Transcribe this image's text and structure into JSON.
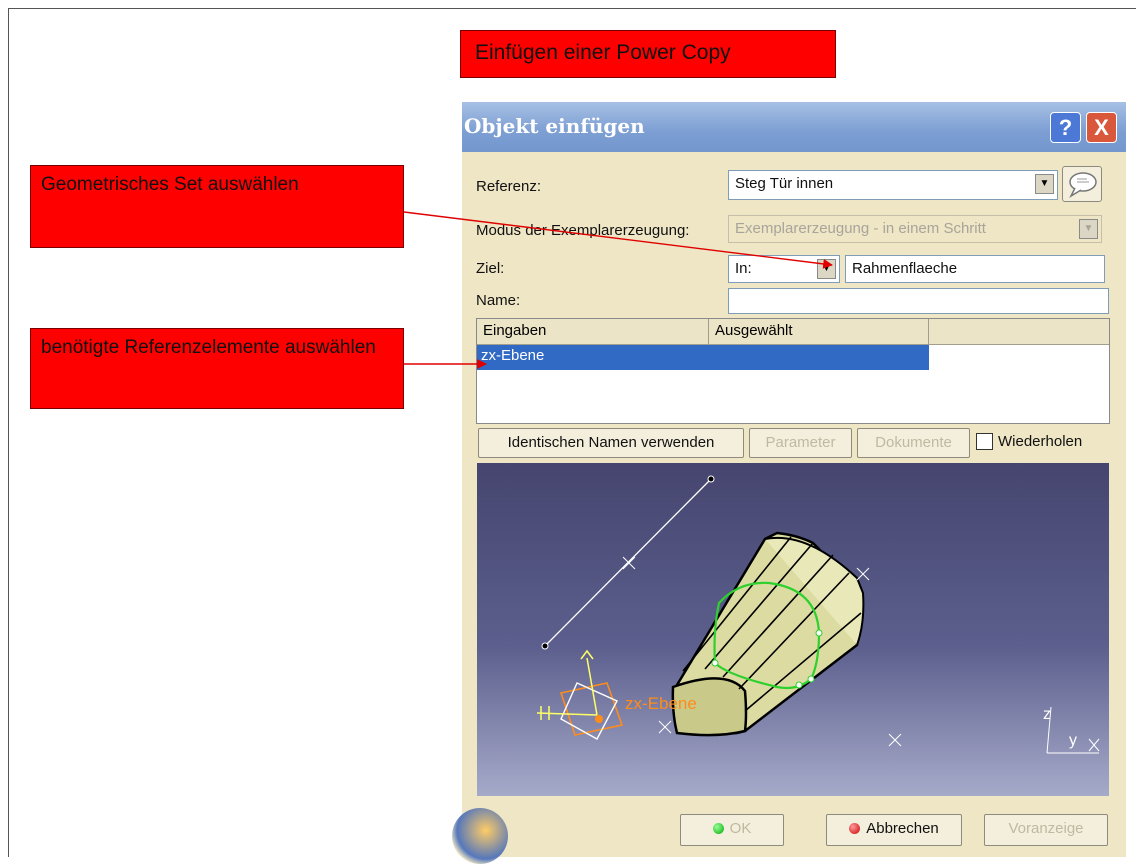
{
  "annotations": {
    "title": "Einfügen einer Power Copy",
    "geo_set": "Geometrisches Set auswählen",
    "ref_elements": "benötigte Referenzelemente auswählen"
  },
  "dialog": {
    "title": "Objekt einfügen",
    "help": "?",
    "close": "X",
    "reference_label": "Referenz:",
    "reference_value": "Steg Tür innen",
    "mode_label": "Modus der Exemplarerzeugung:",
    "mode_value": "Exemplarerzeugung - in einem Schritt",
    "target_label": "Ziel:",
    "target_in": "In:",
    "target_value": "Rahmenflaeche",
    "name_label": "Name:",
    "name_value": "",
    "table": {
      "headers": [
        "Eingaben",
        "Ausgewählt"
      ],
      "rows": [
        {
          "input": "zx-Ebene",
          "selected": ""
        }
      ]
    },
    "buttons": {
      "identical_names": "Identischen Namen verwenden",
      "parameters": "Parameter",
      "documents": "Dokumente",
      "repeat": "Wiederholen",
      "ok": "OK",
      "cancel": "Abbrechen",
      "preview": "Voranzeige"
    },
    "viewer": {
      "plane_label": "zx-Ebene",
      "axis_z": "z",
      "axis_y": "y"
    }
  },
  "colors": {
    "callout_red": "#ff0000",
    "dialog_bg": "#efe6c5",
    "titlebar": "#7c9ed3",
    "selection": "#316ac5",
    "highlight_green": "#2ed02e"
  }
}
